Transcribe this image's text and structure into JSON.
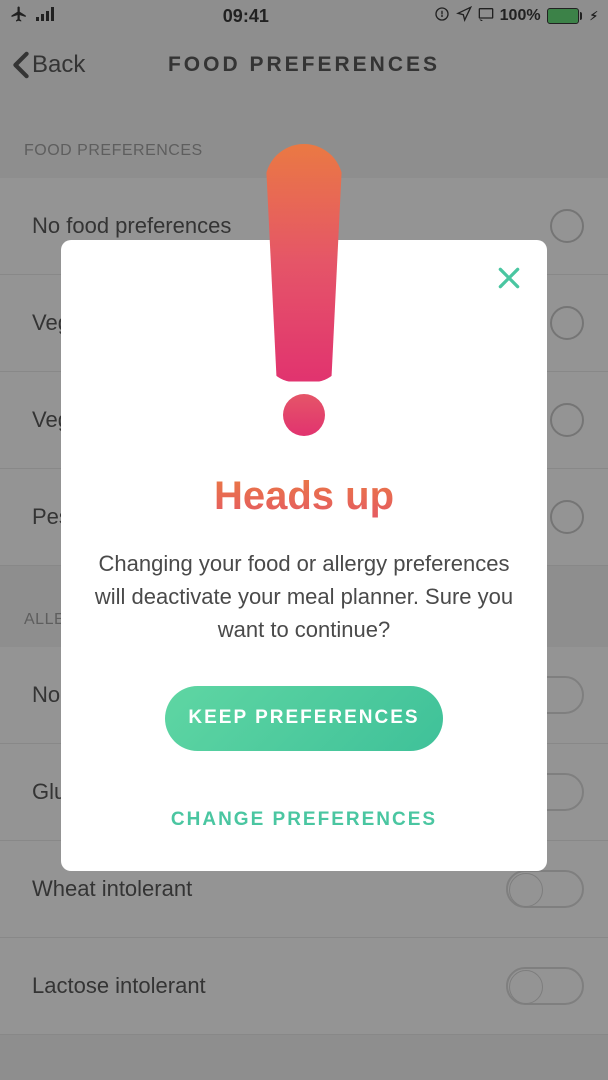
{
  "status": {
    "time": "09:41",
    "battery": "100%"
  },
  "header": {
    "back": "Back",
    "title": "FOOD PREFERENCES"
  },
  "sections": {
    "food": {
      "header": "FOOD PREFERENCES",
      "items": [
        "No food preferences",
        "Vegan",
        "Vegetarian",
        "Pescatarian"
      ]
    },
    "allergies": {
      "header": "ALLERGIES",
      "items": [
        "No allergies",
        "Gluten intolerant",
        "Wheat intolerant",
        "Lactose intolerant"
      ]
    }
  },
  "modal": {
    "title": "Heads up",
    "body": "Changing your food or allergy preferences will deactivate your meal planner. Sure you want to continue?",
    "primary": "KEEP PREFERENCES",
    "secondary": "CHANGE PREFERENCES"
  }
}
